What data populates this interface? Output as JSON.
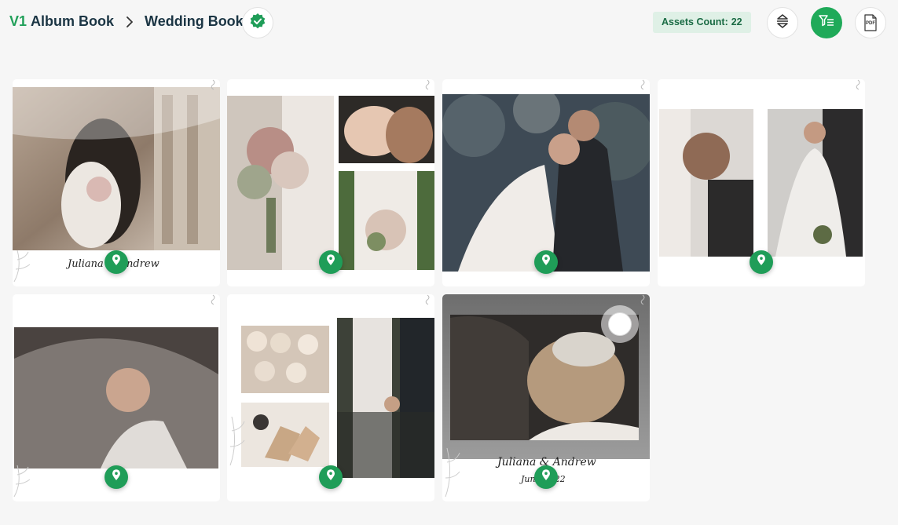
{
  "breadcrumb": {
    "version": "V1",
    "album": "Album Book",
    "book": "Wedding Book"
  },
  "assets": {
    "label": "Assets Count:",
    "count": "22"
  },
  "toolbar": {
    "sort_icon": "sort-arrows-icon",
    "filter_icon": "filter-list-icon",
    "pdf_icon": "pdf-file-icon",
    "pdf_text": "PDF"
  },
  "cards": [
    {
      "caption": "Juliana & Andrew"
    },
    {},
    {},
    {},
    {},
    {},
    {
      "caption": "Juliana & Andrew",
      "date": "June 2022",
      "selected": false
    }
  ],
  "colors": {
    "accent": "#1f9d58",
    "badge_bg": "#dff0e6",
    "background": "#f6f6f6"
  }
}
